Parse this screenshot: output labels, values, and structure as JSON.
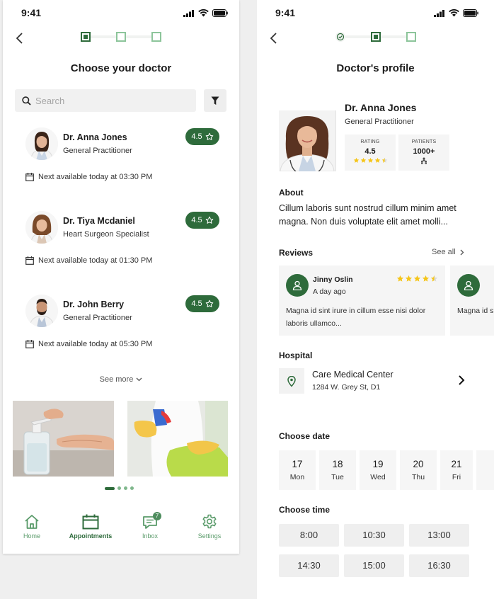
{
  "status_time": "9:41",
  "left": {
    "title": "Choose your doctor",
    "search_placeholder": "Search",
    "doctors": [
      {
        "name": "Dr. Anna Jones",
        "specialty": "General Practitioner",
        "rating": "4.5",
        "next": "Next available today at 03:30 PM"
      },
      {
        "name": "Dr. Tiya Mcdaniel",
        "specialty": "Heart Surgeon Specialist",
        "rating": "4.5",
        "next": "Next available today at 01:30 PM"
      },
      {
        "name": "Dr. John Berry",
        "specialty": "General Practitioner",
        "rating": "4.5",
        "next": "Next available today at 05:30 PM"
      }
    ],
    "see_more": "See more",
    "carousel_active_index": 0,
    "carousel_count": 4,
    "tabs": [
      {
        "label": "Home",
        "icon": "home-icon",
        "active": false
      },
      {
        "label": "Appointments",
        "icon": "calendar-icon",
        "active": true
      },
      {
        "label": "Inbox",
        "icon": "chat-icon",
        "active": false,
        "badge": "7"
      },
      {
        "label": "Settings",
        "icon": "gear-icon",
        "active": false
      }
    ]
  },
  "right": {
    "title": "Doctor's profile",
    "doctor": {
      "name": "Dr. Anna Jones",
      "specialty": "General Practitioner",
      "rating_label": "RATING",
      "rating_value": "4.5",
      "rating_stars": 4.5,
      "patients_label": "PATIENTS",
      "patients_value": "1000+"
    },
    "about_title": "About",
    "about_text": "Cillum laboris sunt nostrud cillum minim amet magna. Non duis voluptate elit amet molli...",
    "reviews_title": "Reviews",
    "see_all": "See all",
    "reviews": [
      {
        "name": "Jinny Oslin",
        "time": "A day ago",
        "stars": 4.5,
        "text": "Magna id sint irure in cillum esse nisi dolor laboris ullamco..."
      },
      {
        "text": "Magna id sint irure laboris ullamco..."
      }
    ],
    "hospital_title": "Hospital",
    "hospital_name": "Care Medical Center",
    "hospital_address": "1284 W. Grey St, D1",
    "date_title": "Choose date",
    "dates": [
      {
        "num": "17",
        "day": "Mon"
      },
      {
        "num": "18",
        "day": "Tue"
      },
      {
        "num": "19",
        "day": "Wed"
      },
      {
        "num": "20",
        "day": "Thu"
      },
      {
        "num": "21",
        "day": "Fri"
      }
    ],
    "time_title": "Choose time",
    "times": [
      "8:00",
      "10:30",
      "13:00",
      "14:30",
      "15:00",
      "16:30"
    ]
  },
  "colors": {
    "primary": "#2e6b3b",
    "accent_light": "#8dc59b",
    "star": "#f5c518"
  }
}
